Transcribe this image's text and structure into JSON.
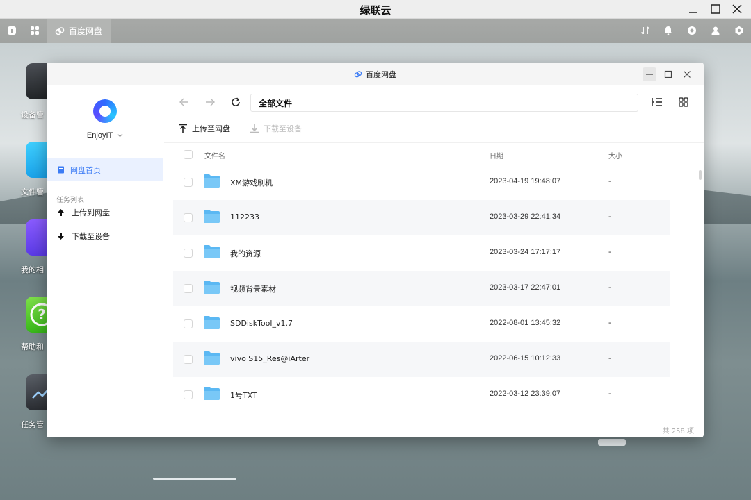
{
  "app": {
    "title": "绿联云"
  },
  "taskbar": {
    "active_tab_label": "百度网盘"
  },
  "desktop": {
    "icons": [
      {
        "label": "设备管"
      },
      {
        "label": "文件管"
      },
      {
        "label": "我的相"
      },
      {
        "label": "帮助和"
      },
      {
        "label": "任务管"
      }
    ]
  },
  "window": {
    "title": "百度网盘"
  },
  "sidebar": {
    "user_name": "EnjoyIT",
    "nav_home": "网盘首页",
    "group_title": "任务列表",
    "items": [
      {
        "label": "上传到网盘"
      },
      {
        "label": "下载至设备"
      }
    ]
  },
  "toolbar": {
    "path": "全部文件",
    "upload_label": "上传至网盘",
    "download_label": "下载至设备"
  },
  "table": {
    "headers": {
      "name": "文件名",
      "date": "日期",
      "size": "大小"
    },
    "rows": [
      {
        "name": "XM游戏刷机",
        "date": "2023-04-19 19:48:07",
        "size": "-"
      },
      {
        "name": "112233",
        "date": "2023-03-29 22:41:34",
        "size": "-"
      },
      {
        "name": "我的资源",
        "date": "2023-03-24 17:17:17",
        "size": "-"
      },
      {
        "name": "视频背景素材",
        "date": "2023-03-17 22:47:01",
        "size": "-"
      },
      {
        "name": "SDDiskTool_v1.7",
        "date": "2022-08-01 13:45:32",
        "size": "-"
      },
      {
        "name": "vivo S15_Res@iArter",
        "date": "2022-06-15 10:12:33",
        "size": "-"
      },
      {
        "name": "1号TXT",
        "date": "2022-03-12 23:39:07",
        "size": "-"
      }
    ]
  },
  "footer": {
    "count": "共 258 项"
  },
  "colors": {
    "accent": "#3c7cf5",
    "folder": "#5bb8f3"
  }
}
